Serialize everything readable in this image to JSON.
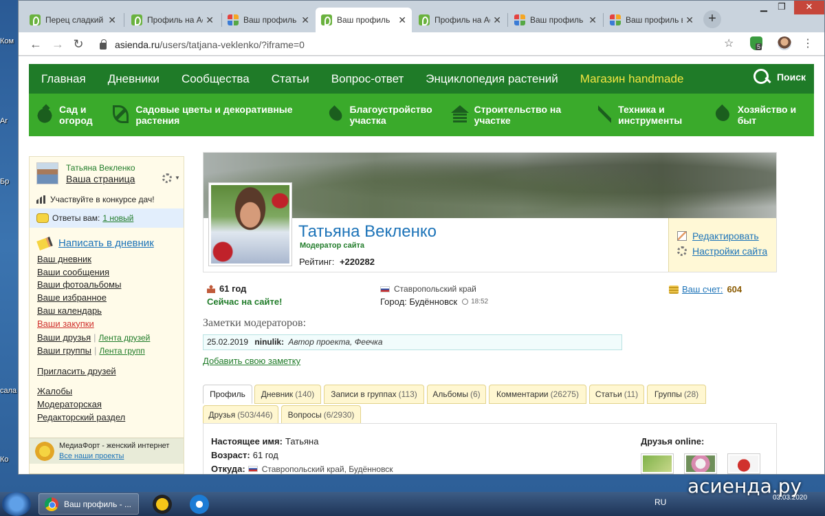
{
  "browser": {
    "tabs": [
      {
        "title": "Перец сладкий",
        "favicon": "asienda-icon",
        "active": false
      },
      {
        "title": "Профиль на Ас",
        "favicon": "asienda-icon",
        "active": false
      },
      {
        "title": "Ваш профиль",
        "favicon": "grid-icon",
        "active": false
      },
      {
        "title": "Ваш профиль",
        "favicon": "asienda-icon",
        "active": true
      },
      {
        "title": "Профиль на Ас",
        "favicon": "asienda-icon",
        "active": false
      },
      {
        "title": "Ваш профиль н",
        "favicon": "grid-icon",
        "active": false
      },
      {
        "title": "Ваш профиль в",
        "favicon": "grid-icon",
        "active": false
      }
    ],
    "url_host": "asienda.ru",
    "url_path": "/users/tatjana-veklenko/?iframe=0",
    "extension_badge": "5"
  },
  "nav": {
    "main": [
      "Главная",
      "Дневники",
      "Сообщества",
      "Статьи",
      "Вопрос-ответ",
      "Энциклопедия растений"
    ],
    "shop": "Магазин handmade",
    "search": "Поиск",
    "categories": [
      {
        "label": "Сад и огород",
        "icon": "tomato-icon"
      },
      {
        "label": "Садовые цветы и декоративные растения",
        "icon": "leaf-icon"
      },
      {
        "label": "Благоустройство участка",
        "icon": "flame-icon"
      },
      {
        "label": "Строительство на участке",
        "icon": "house-icon"
      },
      {
        "label": "Техника и инструменты",
        "icon": "tool-icon"
      },
      {
        "label": "Хозяйство и быт",
        "icon": "fire-icon"
      }
    ]
  },
  "sidebar": {
    "user_name": "Татьяна Векленко",
    "your_page": "Ваша страница",
    "contest": "Участвуйте в конкурсе дач!",
    "answers_label": "Ответы вам:",
    "answers_link": "1 новый",
    "write_diary": "Написать в дневник",
    "links": {
      "diary": "Ваш дневник",
      "messages": "Ваши сообщения",
      "photo_albums": "Ваши фотоальбомы",
      "favorites": "Ваше избранное",
      "calendar": "Ваш календарь",
      "purchases": "Ваши закупки",
      "friends": "Ваши друзья",
      "friends_feed": "Лента друзей",
      "groups": "Ваши группы",
      "groups_feed": "Лента групп",
      "invite": "Пригласить друзей",
      "complaints": "Жалобы",
      "moderator": "Модераторская",
      "editor": "Редакторский раздел"
    },
    "footer_title": "МедиаФорт - женский интернет",
    "footer_link": "Все наши проекты"
  },
  "profile": {
    "name": "Татьяна Векленко",
    "role": "Модератор сайта",
    "rating_label": "Рейтинг:",
    "rating_value": "+220282",
    "edit": "Редактировать",
    "settings": "Настройки сайта",
    "age": "61 год",
    "status": "Сейчас на сайте!",
    "region": "Ставропольский край",
    "city_label": "Город:",
    "city": "Будённовск",
    "local_time": "18:52",
    "account_label": "Ваш счет:",
    "account_value": "604"
  },
  "notes": {
    "title": "Заметки модераторов:",
    "date": "25.02.2019",
    "author": "ninulik:",
    "text": "Автор проекта, Феечка",
    "add": "Добавить свою заметку"
  },
  "tabs": [
    {
      "label": "Профиль",
      "count": ""
    },
    {
      "label": "Дневник",
      "count": "(140)"
    },
    {
      "label": "Записи в группах",
      "count": "(113)"
    },
    {
      "label": "Альбомы",
      "count": "(6)"
    },
    {
      "label": "Комментарии",
      "count": "(26275)"
    },
    {
      "label": "Статьи",
      "count": "(11)"
    },
    {
      "label": "Группы",
      "count": "(28)"
    },
    {
      "label": "Друзья",
      "count": "(503/446)"
    },
    {
      "label": "Вопросы",
      "count": "(6/2930)"
    }
  ],
  "details": {
    "real_name_label": "Настоящее имя:",
    "real_name": "Татьяна",
    "age_label": "Возраст:",
    "age": "61 год",
    "from_label": "Откуда:",
    "from": "Ставропольский край, Будённовск",
    "friends_online": "Друзья online:"
  },
  "taskbar": {
    "window_title": "Ваш профиль - ...",
    "lang": "RU",
    "date": "03.03.2020",
    "watermark": "асиенда.ру"
  }
}
